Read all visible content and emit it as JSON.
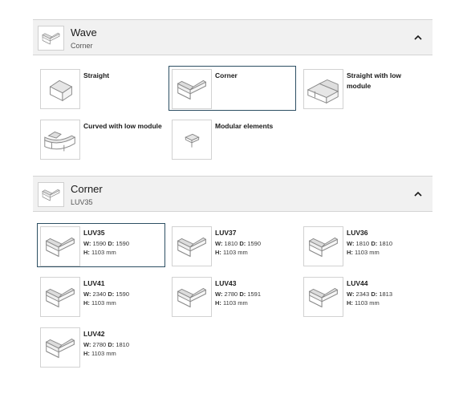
{
  "wave_section": {
    "title": "Wave",
    "subtitle": "Corner",
    "header_icon": "corner-module-icon",
    "chevron_icon": "chevron-up-icon",
    "items": [
      {
        "label": "Straight",
        "icon": "straight-module-icon",
        "selected": false
      },
      {
        "label": "Corner",
        "icon": "corner-module-icon",
        "selected": true
      },
      {
        "label": "Straight with low module",
        "icon": "straight-low-module-icon",
        "selected": false
      },
      {
        "label": "Curved with low module",
        "icon": "curved-low-module-icon",
        "selected": false
      },
      {
        "label": "Modular elements",
        "icon": "modular-element-icon",
        "selected": false
      }
    ]
  },
  "corner_section": {
    "title": "Corner",
    "subtitle": "LUV35",
    "header_icon": "corner-module-icon",
    "chevron_icon": "chevron-up-icon",
    "dim_labels": {
      "w": "W:",
      "d": "D:",
      "h": "H:"
    },
    "items": [
      {
        "label": "LUV35",
        "w": "1590",
        "d": "1590",
        "h": "1103 mm",
        "icon": "corner-module-icon",
        "selected": true
      },
      {
        "label": "LUV37",
        "w": "1810",
        "d": "1590",
        "h": "1103 mm",
        "icon": "corner-module-icon",
        "selected": false
      },
      {
        "label": "LUV36",
        "w": "1810",
        "d": "1810",
        "h": "1103 mm",
        "icon": "corner-module-icon",
        "selected": false
      },
      {
        "label": "LUV41",
        "w": "2340",
        "d": "1590",
        "h": "1103 mm",
        "icon": "corner-module-icon",
        "selected": false
      },
      {
        "label": "LUV43",
        "w": "2780",
        "d": "1591",
        "h": "1103 mm",
        "icon": "corner-module-icon",
        "selected": false
      },
      {
        "label": "LUV44",
        "w": "2343",
        "d": "1813",
        "h": "1103 mm",
        "icon": "corner-module-icon",
        "selected": false
      },
      {
        "label": "LUV42",
        "w": "2780",
        "d": "1810",
        "h": "1103 mm",
        "icon": "corner-module-icon",
        "selected": false
      }
    ]
  },
  "colors": {
    "selected_border": "#2d4f63",
    "header_bg": "#f1f1f1",
    "divider": "#d4d4d4"
  }
}
